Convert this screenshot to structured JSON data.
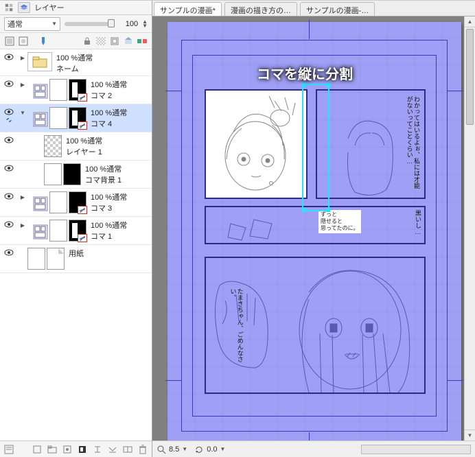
{
  "sidebar": {
    "panel_title": "レイヤー",
    "blend_mode": "通常",
    "opacity": "100",
    "layers": [
      {
        "opacity_mode": "100 %通常",
        "name": "ネーム",
        "type": "folder",
        "visible": true,
        "expand": "▶",
        "indent": 0
      },
      {
        "opacity_mode": "100 %通常",
        "name": "コマ 2",
        "type": "frame",
        "visible": true,
        "expand": "▶",
        "indent": 1,
        "mask": "white"
      },
      {
        "opacity_mode": "100 %通常",
        "name": "コマ 4",
        "type": "frame",
        "visible": true,
        "expand": "▼",
        "indent": 1,
        "mask": "white",
        "selected": true,
        "linked": true
      },
      {
        "opacity_mode": "100 %通常",
        "name": "レイヤー 1",
        "type": "raster",
        "visible": true,
        "indent": 2
      },
      {
        "opacity_mode": "100 %通常",
        "name": "コマ背景 1",
        "type": "framefill",
        "visible": true,
        "indent": 2,
        "mask": "black"
      },
      {
        "opacity_mode": "100 %通常",
        "name": "コマ 3",
        "type": "frame",
        "visible": true,
        "expand": "▶",
        "indent": 1,
        "mask": "black"
      },
      {
        "opacity_mode": "100 %通常",
        "name": "コマ 1",
        "type": "frame",
        "visible": true,
        "expand": "▶",
        "indent": 1,
        "mask": "white"
      },
      {
        "name": "用紙",
        "type": "paper",
        "visible": true,
        "indent": 0
      }
    ]
  },
  "tabs": [
    {
      "label": "サンプルの漫画*",
      "active": true
    },
    {
      "label": "漫画の描き方の…",
      "active": false
    },
    {
      "label": "サンプルの漫画-…",
      "active": false
    }
  ],
  "annotation": "コマを縦に分割",
  "captions": {
    "p2": "わかってはいるよぉ、私には才能がないってことくらい…",
    "p3a": "ずっと",
    "p3b": "隠せると",
    "p3c": "思ってたのに。",
    "p4": "黒いし…",
    "p5": "たまきちゃん、ごめんなさい。"
  },
  "status": {
    "zoom": "8.5",
    "rotate": "0.0"
  }
}
